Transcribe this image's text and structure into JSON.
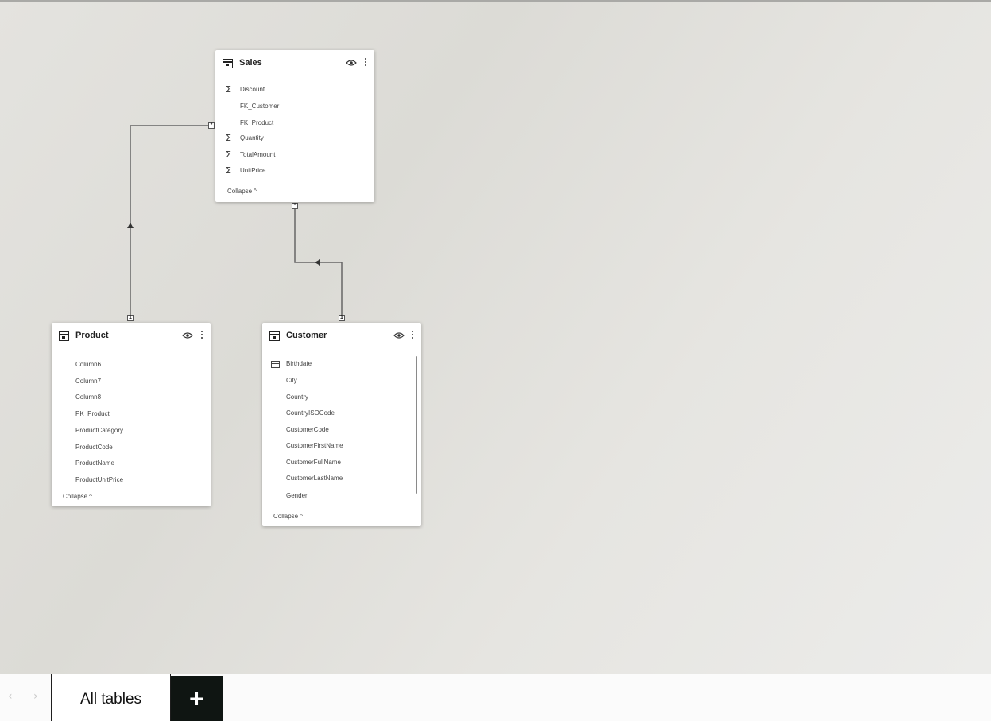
{
  "tables": {
    "sales": {
      "title": "Sales",
      "fields": [
        {
          "label": "Discount",
          "icon": "sigma-icon"
        },
        {
          "label": "FK_Customer",
          "icon": ""
        },
        {
          "label": "FK_Product",
          "icon": ""
        },
        {
          "label": "Quantity",
          "icon": "sigma-icon"
        },
        {
          "label": "TotalAmount",
          "icon": "sigma-icon"
        },
        {
          "label": "UnitPrice",
          "icon": "sigma-icon"
        }
      ],
      "collapse_label": "Collapse"
    },
    "product": {
      "title": "Product",
      "fields": [
        {
          "label": "Column6",
          "icon": ""
        },
        {
          "label": "Column7",
          "icon": ""
        },
        {
          "label": "Column8",
          "icon": ""
        },
        {
          "label": "PK_Product",
          "icon": ""
        },
        {
          "label": "ProductCategory",
          "icon": ""
        },
        {
          "label": "ProductCode",
          "icon": ""
        },
        {
          "label": "ProductName",
          "icon": ""
        },
        {
          "label": "ProductUnitPrice",
          "icon": ""
        }
      ],
      "collapse_label": "Collapse"
    },
    "customer": {
      "title": "Customer",
      "fields": [
        {
          "label": "Birthdate",
          "icon": "calendar-icon"
        },
        {
          "label": "City",
          "icon": ""
        },
        {
          "label": "Country",
          "icon": ""
        },
        {
          "label": "CountryISOCode",
          "icon": ""
        },
        {
          "label": "CustomerCode",
          "icon": ""
        },
        {
          "label": "CustomerFirstName",
          "icon": ""
        },
        {
          "label": "CustomerFullName",
          "icon": ""
        },
        {
          "label": "CustomerLastName",
          "icon": ""
        },
        {
          "label": "Gender",
          "icon": ""
        }
      ],
      "collapse_label": "Collapse"
    }
  },
  "relationships": {
    "product_sales": {
      "one_label": "1",
      "many_label": "*"
    },
    "customer_sales": {
      "one_label": "1",
      "many_label": "*"
    }
  },
  "bottom_bar": {
    "prev_arrow": "‹",
    "next_arrow": "›",
    "tab_label": "All tables",
    "add_label": "+"
  },
  "colors": {
    "canvas": "#e0dfdb",
    "card": "#ffffff",
    "line": "#555555",
    "add_button": "#0f1512"
  }
}
